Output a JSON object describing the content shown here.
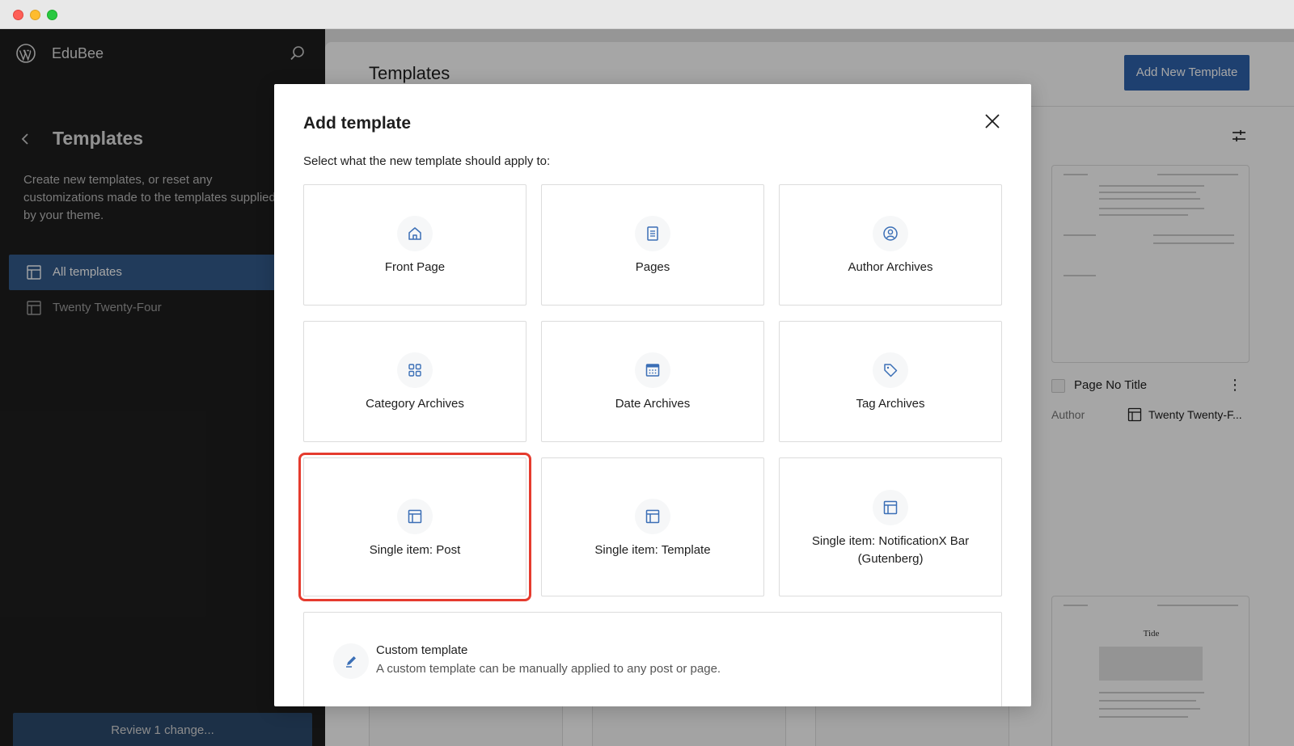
{
  "sidebar": {
    "site_name": "EduBee",
    "title": "Templates",
    "description": "Create new templates, or reset any\ncustomizations made to the templates supplied\nby your theme.",
    "items": [
      {
        "label": "All templates"
      },
      {
        "label": "Twenty Twenty-Four"
      }
    ],
    "review_button": "Review 1 change..."
  },
  "main": {
    "title": "Templates",
    "add_new_button": "Add New Template",
    "card": {
      "title": "Page No Title",
      "menu": "⋮",
      "author_label": "Author",
      "theme": "Twenty Twenty-F..."
    },
    "thumb2_title": "Tide"
  },
  "modal": {
    "title": "Add template",
    "subtitle": "Select what the new template should apply to:",
    "tiles": [
      {
        "label": "Front Page",
        "icon": "home-icon"
      },
      {
        "label": "Pages",
        "icon": "page-icon"
      },
      {
        "label": "Author Archives",
        "icon": "user-icon"
      },
      {
        "label": "Category Archives",
        "icon": "category-icon"
      },
      {
        "label": "Date Archives",
        "icon": "calendar-icon"
      },
      {
        "label": "Tag Archives",
        "icon": "tag-icon"
      },
      {
        "label": "Single item: Post",
        "icon": "layout-icon"
      },
      {
        "label": "Single item: Template",
        "icon": "layout-icon"
      },
      {
        "label": "Single item: NotificationX Bar (Gutenberg)",
        "icon": "layout-icon"
      }
    ],
    "custom": {
      "title": "Custom template",
      "description": "A custom template can be manually applied to any post or page."
    }
  },
  "colors": {
    "accent": "#2f63ad",
    "highlight": "#e53b2e",
    "icon_blue": "#3b6fb6"
  }
}
